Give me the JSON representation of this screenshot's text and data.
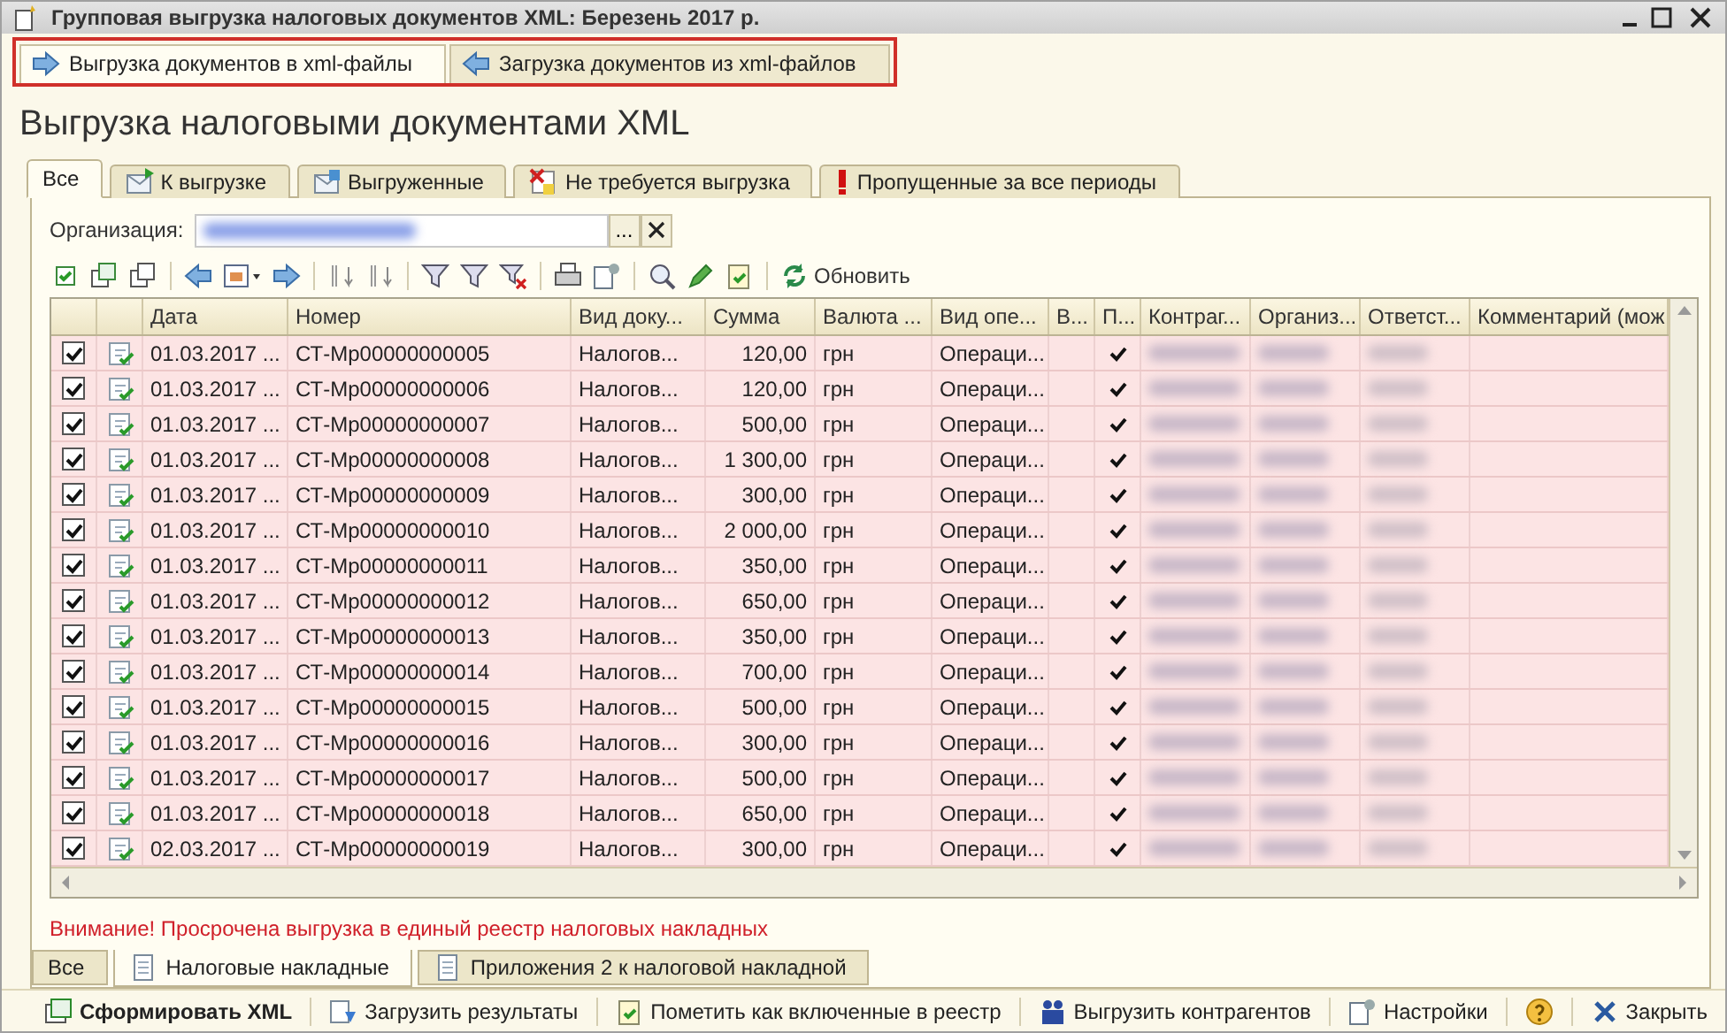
{
  "window": {
    "title": "Групповая выгрузка налоговых документов XML: Березень 2017 р."
  },
  "top_tabs": [
    {
      "label": "Выгрузка документов в xml-файлы",
      "selected": true
    },
    {
      "label": "Загрузка документов из xml-файлов",
      "selected": false
    }
  ],
  "heading": "Выгрузка налоговыми документами XML",
  "tabs": [
    {
      "label": "Все",
      "selected": true,
      "kind": "plain"
    },
    {
      "label": "К выгрузке",
      "selected": false,
      "kind": "send"
    },
    {
      "label": "Выгруженные",
      "selected": false,
      "kind": "sent"
    },
    {
      "label": "Не требуется выгрузка",
      "selected": false,
      "kind": "skip"
    },
    {
      "label": "Пропущенные за все периоды",
      "selected": false,
      "kind": "alert"
    }
  ],
  "organization": {
    "label": "Организация:",
    "select_button": "..."
  },
  "toolbar": {
    "refresh": "Обновить"
  },
  "table": {
    "columns": [
      "Дата",
      "Номер",
      "Вид доку...",
      "Сумма",
      "Валюта ...",
      "Вид опе...",
      "В...",
      "П...",
      "Контраг...",
      "Организ...",
      "Ответст...",
      "Комментарий (мож"
    ],
    "rows": [
      {
        "checked": true,
        "date": "01.03.2017 ...",
        "number": "СТ-Мр00000000005",
        "doc_type": "Налогов...",
        "sum": "120,00",
        "currency": "грн",
        "operation": "Операци...",
        "posted": true
      },
      {
        "checked": true,
        "date": "01.03.2017 ...",
        "number": "СТ-Мр00000000006",
        "doc_type": "Налогов...",
        "sum": "120,00",
        "currency": "грн",
        "operation": "Операци...",
        "posted": true
      },
      {
        "checked": true,
        "date": "01.03.2017 ...",
        "number": "СТ-Мр00000000007",
        "doc_type": "Налогов...",
        "sum": "500,00",
        "currency": "грн",
        "operation": "Операци...",
        "posted": true
      },
      {
        "checked": true,
        "date": "01.03.2017 ...",
        "number": "СТ-Мр00000000008",
        "doc_type": "Налогов...",
        "sum": "1 300,00",
        "currency": "грн",
        "operation": "Операци...",
        "posted": true
      },
      {
        "checked": true,
        "date": "01.03.2017 ...",
        "number": "СТ-Мр00000000009",
        "doc_type": "Налогов...",
        "sum": "300,00",
        "currency": "грн",
        "operation": "Операци...",
        "posted": true
      },
      {
        "checked": true,
        "date": "01.03.2017 ...",
        "number": "СТ-Мр00000000010",
        "doc_type": "Налогов...",
        "sum": "2 000,00",
        "currency": "грн",
        "operation": "Операци...",
        "posted": true
      },
      {
        "checked": true,
        "date": "01.03.2017 ...",
        "number": "СТ-Мр00000000011",
        "doc_type": "Налогов...",
        "sum": "350,00",
        "currency": "грн",
        "operation": "Операци...",
        "posted": true
      },
      {
        "checked": true,
        "date": "01.03.2017 ...",
        "number": "СТ-Мр00000000012",
        "doc_type": "Налогов...",
        "sum": "650,00",
        "currency": "грн",
        "operation": "Операци...",
        "posted": true
      },
      {
        "checked": true,
        "date": "01.03.2017 ...",
        "number": "СТ-Мр00000000013",
        "doc_type": "Налогов...",
        "sum": "350,00",
        "currency": "грн",
        "operation": "Операци...",
        "posted": true
      },
      {
        "checked": true,
        "date": "01.03.2017 ...",
        "number": "СТ-Мр00000000014",
        "doc_type": "Налогов...",
        "sum": "700,00",
        "currency": "грн",
        "operation": "Операци...",
        "posted": true
      },
      {
        "checked": true,
        "date": "01.03.2017 ...",
        "number": "СТ-Мр00000000015",
        "doc_type": "Налогов...",
        "sum": "500,00",
        "currency": "грн",
        "operation": "Операци...",
        "posted": true
      },
      {
        "checked": true,
        "date": "01.03.2017 ...",
        "number": "СТ-Мр00000000016",
        "doc_type": "Налогов...",
        "sum": "300,00",
        "currency": "грн",
        "operation": "Операци...",
        "posted": true
      },
      {
        "checked": true,
        "date": "01.03.2017 ...",
        "number": "СТ-Мр00000000017",
        "doc_type": "Налогов...",
        "sum": "500,00",
        "currency": "грн",
        "operation": "Операци...",
        "posted": true
      },
      {
        "checked": true,
        "date": "01.03.2017 ...",
        "number": "СТ-Мр00000000018",
        "doc_type": "Налогов...",
        "sum": "650,00",
        "currency": "грн",
        "operation": "Операци...",
        "posted": true
      },
      {
        "checked": true,
        "date": "02.03.2017 ...",
        "number": "СТ-Мр00000000019",
        "doc_type": "Налогов...",
        "sum": "300,00",
        "currency": "грн",
        "operation": "Операци...",
        "posted": true
      }
    ]
  },
  "warning": "Внимание! Просрочена выгрузка в единый реестр налоговых накладных",
  "bottom_tabs": [
    {
      "label": "Все",
      "selected": false,
      "kind": "plain"
    },
    {
      "label": "Налоговые накладные",
      "selected": true,
      "kind": "doc"
    },
    {
      "label": "Приложения 2 к налоговой накладной",
      "selected": false,
      "kind": "doc"
    }
  ],
  "commands": [
    {
      "label": "Сформировать XML",
      "bold": true,
      "kind": "xml"
    },
    {
      "label": "Загрузить результаты",
      "bold": false,
      "kind": "load"
    },
    {
      "label": "Пометить как включенные в реестр",
      "bold": false,
      "kind": "mark"
    },
    {
      "label": "Выгрузить контрагентов",
      "bold": false,
      "kind": "people"
    },
    {
      "label": "Настройки",
      "bold": false,
      "kind": "settings"
    },
    {
      "bold": false,
      "kind": "help"
    },
    {
      "label": "Закрыть",
      "bold": false,
      "kind": "close"
    }
  ]
}
